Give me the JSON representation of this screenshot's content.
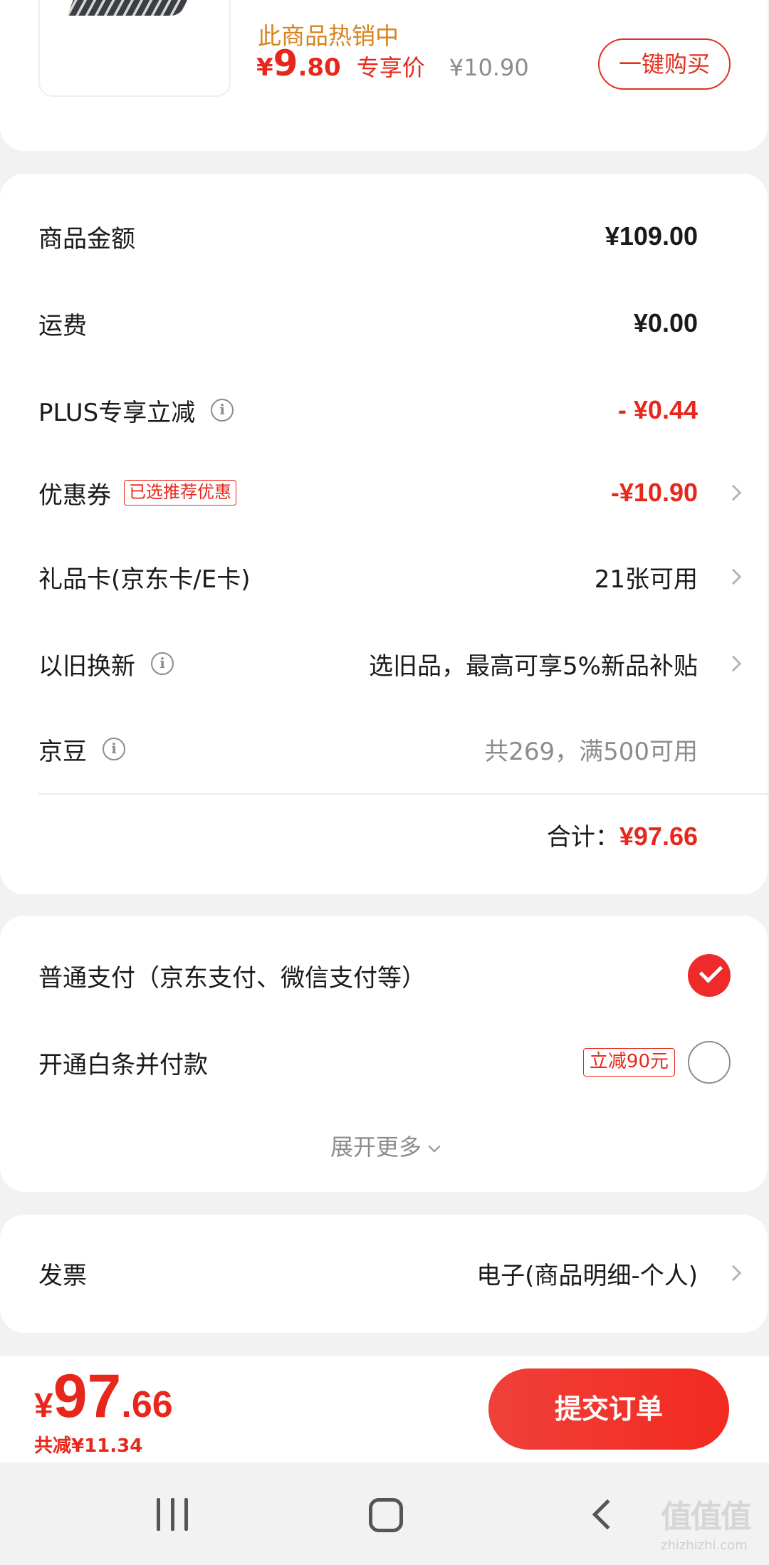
{
  "product": {
    "hot_text": "此商品热销中",
    "price_yen": "¥",
    "price_int": "9",
    "price_dec": ".80",
    "exclusive_label": "专享价",
    "original_price": "¥10.90",
    "buy_button": "一键购买"
  },
  "summary": {
    "goods_amount": {
      "label": "商品金额",
      "value": "¥109.00"
    },
    "shipping": {
      "label": "运费",
      "value": "¥0.00"
    },
    "plus": {
      "label": "PLUS专享立减",
      "value": "- ¥0.44"
    },
    "coupon": {
      "label": "优惠券",
      "badge": "已选推荐优惠",
      "value": "-¥10.90"
    },
    "gift_card": {
      "label": "礼品卡(京东卡/E卡)",
      "value": "21张可用"
    },
    "trade_in": {
      "label": "以旧换新",
      "value": "选旧品，最高可享5%新品补贴"
    },
    "jingdou": {
      "label": "京豆",
      "value": "共269，满500可用"
    },
    "total_label": "合计：",
    "total_value": "¥97.66"
  },
  "payment": {
    "normal": {
      "label": "普通支付（京东支付、微信支付等）",
      "selected": true
    },
    "baitiao": {
      "label": "开通白条并付款",
      "badge": "立减90元",
      "selected": false
    },
    "expand_label": "展开更多"
  },
  "invoice": {
    "label": "发票",
    "value": "电子(商品明细-个人)"
  },
  "bottom_bar": {
    "yen": "¥",
    "price_int": "97",
    "price_dec": ".66",
    "savings": "共减¥11.34",
    "submit_label": "提交订单"
  },
  "watermark": {
    "main": "值值值",
    "sub": "zhizhizhi.com"
  },
  "colors": {
    "accent": "#e8271c",
    "hot": "#d8851e",
    "muted": "#8c8c8c",
    "background": "#f2f2f2"
  },
  "icons": [
    "info-icon",
    "chevron-right-icon",
    "check-icon",
    "chevron-down-icon",
    "recent-apps-icon",
    "home-icon",
    "back-icon"
  ]
}
